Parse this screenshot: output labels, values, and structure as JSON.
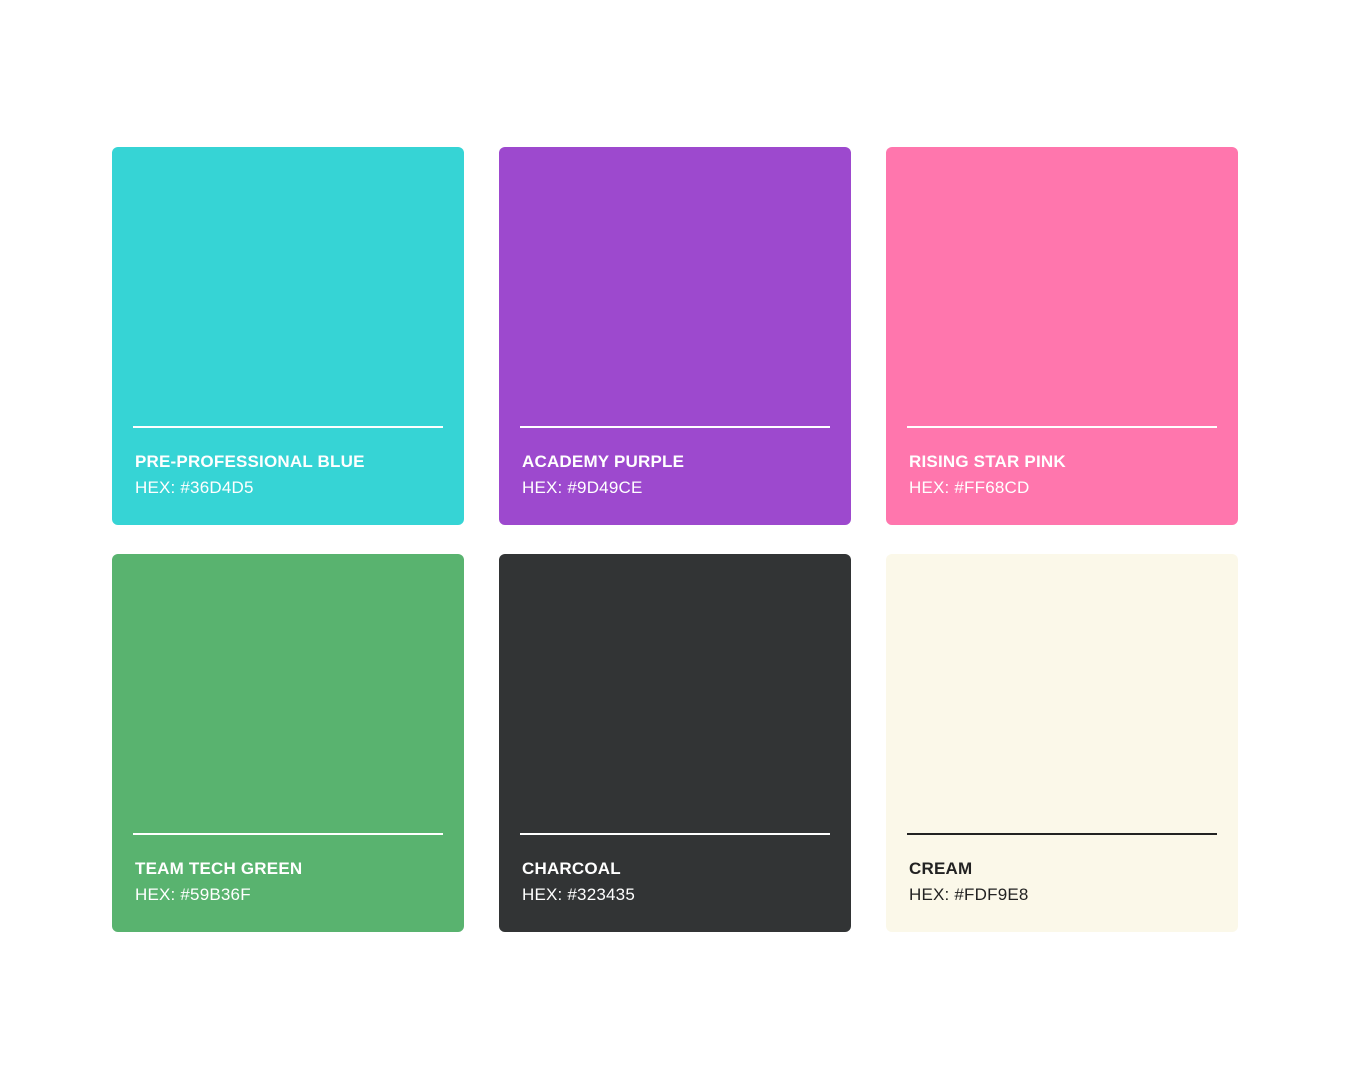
{
  "swatches": [
    {
      "name": "PRE-PROFESSIONAL BLUE",
      "hex_label": "HEX: #36D4D5",
      "color": "#36D4D5"
    },
    {
      "name": "ACADEMY PURPLE",
      "hex_label": "HEX: #9D49CE",
      "color": "#9D49CE"
    },
    {
      "name": "RISING STAR PINK",
      "hex_label": "HEX: #FF68CD",
      "color": "#FF76AD"
    },
    {
      "name": "TEAM TECH GREEN",
      "hex_label": "HEX: #59B36F",
      "color": "#59B36F"
    },
    {
      "name": "CHARCOAL",
      "hex_label": "HEX: #323435",
      "color": "#323435"
    },
    {
      "name": "CREAM",
      "hex_label": "HEX: #FDF9E8",
      "color": "#FBF8E9"
    }
  ]
}
